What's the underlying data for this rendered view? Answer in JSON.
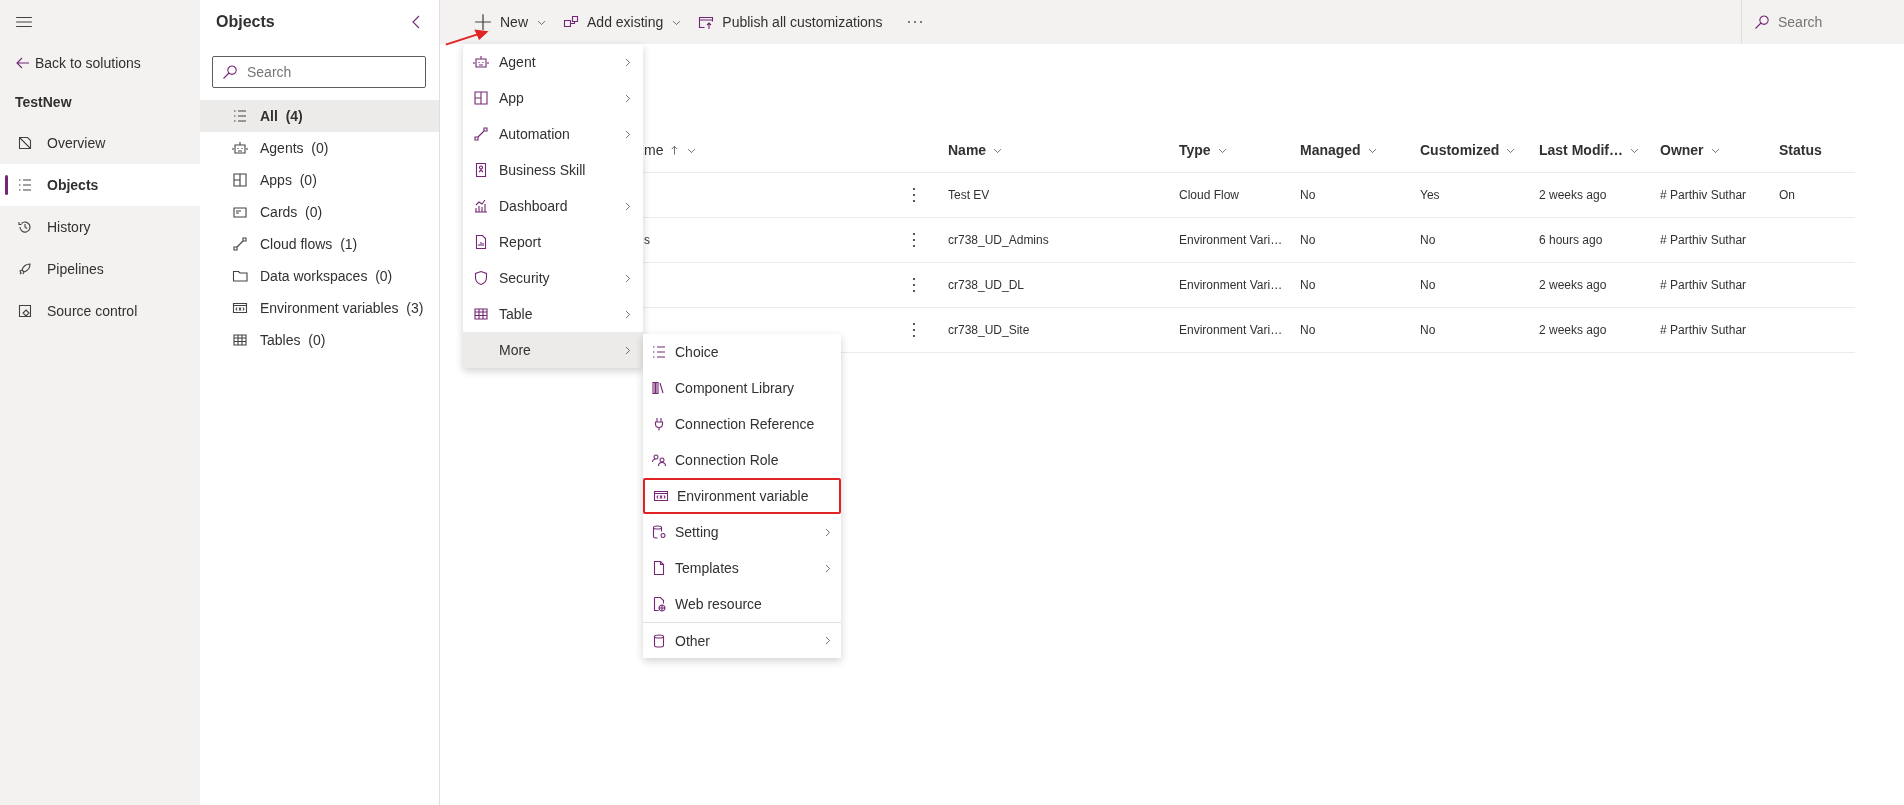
{
  "nav": {
    "back": "Back to solutions",
    "solution": "TestNew",
    "items": [
      {
        "label": "Overview",
        "selected": false
      },
      {
        "label": "Objects",
        "selected": true
      },
      {
        "label": "History",
        "selected": false
      },
      {
        "label": "Pipelines",
        "selected": false
      },
      {
        "label": "Source control",
        "selected": false
      }
    ]
  },
  "objects_panel": {
    "title": "Objects",
    "search": {
      "placeholder": "Search"
    },
    "items": [
      {
        "label": "All",
        "count": "(4)",
        "selected": true
      },
      {
        "label": "Agents",
        "count": "(0)",
        "selected": false
      },
      {
        "label": "Apps",
        "count": "(0)",
        "selected": false
      },
      {
        "label": "Cards",
        "count": "(0)",
        "selected": false
      },
      {
        "label": "Cloud flows",
        "count": "(1)",
        "selected": false
      },
      {
        "label": "Data workspaces",
        "count": "(0)",
        "selected": false
      },
      {
        "label": "Environment variables",
        "count": "(3)",
        "selected": false
      },
      {
        "label": "Tables",
        "count": "(0)",
        "selected": false
      }
    ]
  },
  "toolbar": {
    "buttons": [
      {
        "label": "New",
        "dropdown": true
      },
      {
        "label": "Add existing",
        "dropdown": true
      },
      {
        "label": "Publish all customizations",
        "dropdown": false
      }
    ],
    "search": {
      "placeholder": "Search"
    }
  },
  "table": {
    "columns": [
      {
        "label": "me",
        "sorted": true,
        "filter": true
      },
      {
        "label": "Name",
        "sorted": false,
        "filter": true
      },
      {
        "label": "Type",
        "sorted": false,
        "filter": true
      },
      {
        "label": "Managed",
        "sorted": false,
        "filter": true
      },
      {
        "label": "Customized",
        "sorted": false,
        "filter": true
      },
      {
        "label": "Last Modif…",
        "sorted": false,
        "filter": true
      },
      {
        "label": "Owner",
        "sorted": false,
        "filter": true
      },
      {
        "label": "Status",
        "sorted": false,
        "filter": false
      }
    ],
    "rows": [
      {
        "name": "Test EV",
        "type": "Cloud Flow",
        "managed": "No",
        "customized": "Yes",
        "last_modified": "2 weeks ago",
        "owner": "# Parthiv Suthar",
        "status": "On"
      },
      {
        "column_1": "s",
        "name": "cr738_UD_Admins",
        "type": "Environment Vari…",
        "managed": "No",
        "customized": "No",
        "last_modified": "6 hours ago",
        "owner": "# Parthiv Suthar"
      },
      {
        "name": "cr738_UD_DL",
        "type": "Environment Vari…",
        "managed": "No",
        "customized": "No",
        "last_modified": "2 weeks ago",
        "owner": "# Parthiv Suthar"
      },
      {
        "name": "cr738_UD_Site",
        "type": "Environment Vari…",
        "managed": "No",
        "customized": "No",
        "last_modified": "2 weeks ago",
        "owner": "# Parthiv Suthar"
      }
    ]
  },
  "new_menu": {
    "items": [
      {
        "label": "Agent",
        "submenu": true,
        "selected": false
      },
      {
        "label": "App",
        "submenu": true,
        "selected": false
      },
      {
        "label": "Automation",
        "submenu": true,
        "selected": false
      },
      {
        "label": "Business Skill",
        "submenu": false,
        "selected": false
      },
      {
        "label": "Dashboard",
        "submenu": true,
        "selected": false
      },
      {
        "label": "Report",
        "submenu": false,
        "selected": false
      },
      {
        "label": "Security",
        "submenu": true,
        "selected": false
      },
      {
        "label": "Table",
        "submenu": true,
        "selected": false
      },
      {
        "label": "More",
        "submenu": true,
        "selected": true
      }
    ]
  },
  "more_menu": {
    "items": [
      {
        "label": "Choice",
        "submenu": false,
        "highlighted": false,
        "divider_before": false
      },
      {
        "label": "Component Library",
        "submenu": false,
        "highlighted": false,
        "divider_before": false
      },
      {
        "label": "Connection Reference",
        "submenu": false,
        "highlighted": false,
        "divider_before": false
      },
      {
        "label": "Connection Role",
        "submenu": false,
        "highlighted": false,
        "divider_before": false
      },
      {
        "label": "Environment variable",
        "submenu": false,
        "highlighted": true,
        "divider_before": false
      },
      {
        "label": "Setting",
        "submenu": true,
        "highlighted": false,
        "divider_before": false
      },
      {
        "label": "Templates",
        "submenu": true,
        "highlighted": false,
        "divider_before": false
      },
      {
        "label": "Web resource",
        "submenu": false,
        "highlighted": false,
        "divider_before": false
      },
      {
        "label": "Other",
        "submenu": true,
        "highlighted": false,
        "divider_before": true
      }
    ]
  }
}
